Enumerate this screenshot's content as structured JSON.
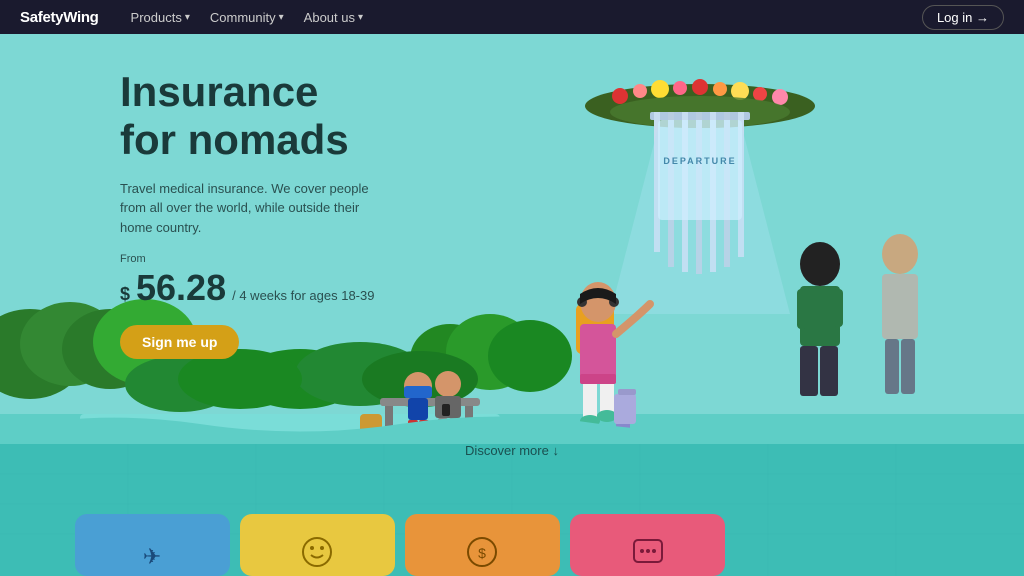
{
  "brand": "SafetyWing",
  "nav": {
    "items": [
      {
        "label": "Products",
        "hasDropdown": true
      },
      {
        "label": "Community",
        "hasDropdown": true
      },
      {
        "label": "About us",
        "hasDropdown": true
      }
    ],
    "login_label": "Log in →"
  },
  "hero": {
    "title_line1": "Insurance",
    "title_line2": "for nomads",
    "subtitle": "Travel medical insurance. We cover people from all over the world, while outside their home country.",
    "price_from": "From",
    "price_symbol": "$",
    "price_amount": "56.28",
    "price_period": "/ 4 weeks for ages 18-39",
    "cta_label": "Sign me up",
    "discover_label": "Discover more ↓"
  },
  "bottom_cards": [
    {
      "color": "#4a9fd4",
      "icon": "✈"
    },
    {
      "color": "#e8c840",
      "icon": "😊"
    },
    {
      "color": "#e8943a",
      "icon": "💰"
    },
    {
      "color": "#e85a7a",
      "icon": "💬"
    }
  ],
  "portal_text": "DEPARTURE"
}
